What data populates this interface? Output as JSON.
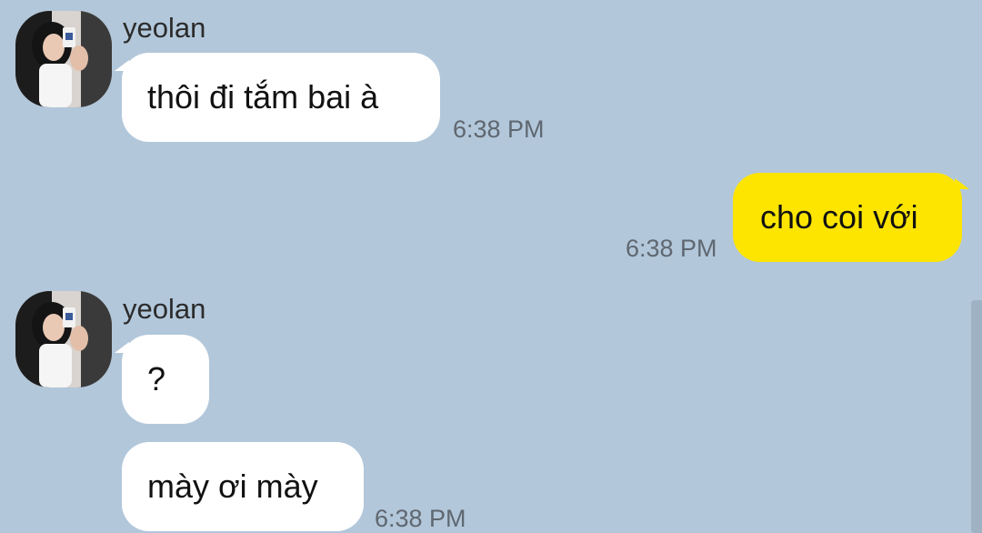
{
  "messages": [
    {
      "sender": "yeolan",
      "text": "thôi đi tắm bai à",
      "time": "6:38 PM",
      "direction": "incoming"
    },
    {
      "sender": "",
      "text": "cho coi với",
      "time": "6:38 PM",
      "direction": "outgoing"
    },
    {
      "sender": "yeolan",
      "text": "?",
      "time": "",
      "direction": "incoming"
    },
    {
      "sender": "",
      "text": "mày ơi mày",
      "time": "6:38 PM",
      "direction": "incoming"
    }
  ],
  "colors": {
    "background": "#b2c7da",
    "incoming_bubble": "#ffffff",
    "outgoing_bubble": "#fee500",
    "timestamp": "#5f6770"
  },
  "icons": {
    "avatar": "profile-photo"
  }
}
